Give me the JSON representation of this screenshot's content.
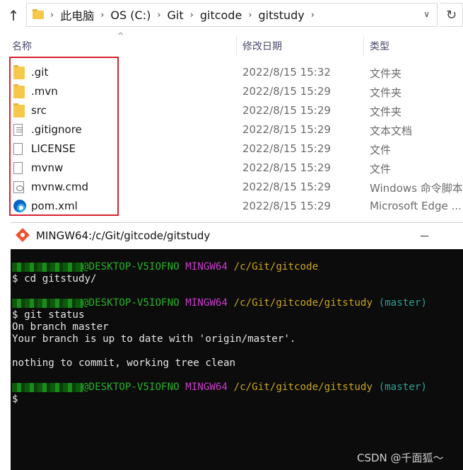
{
  "explorer": {
    "breadcrumb": [
      "此电脑",
      "OS (C:)",
      "Git",
      "gitcode",
      "gitstudy"
    ],
    "columns": {
      "name": "名称",
      "date": "修改日期",
      "type": "类型"
    },
    "files": [
      {
        "name": ".git",
        "date": "2022/8/15 15:32",
        "type": "文件夹",
        "icon": "folder-icon"
      },
      {
        "name": ".mvn",
        "date": "2022/8/15 15:29",
        "type": "文件夹",
        "icon": "folder-icon"
      },
      {
        "name": "src",
        "date": "2022/8/15 15:29",
        "type": "文件夹",
        "icon": "folder-icon"
      },
      {
        "name": ".gitignore",
        "date": "2022/8/15 15:29",
        "type": "文本文档",
        "icon": "text-file-icon"
      },
      {
        "name": "LICENSE",
        "date": "2022/8/15 15:29",
        "type": "文件",
        "icon": "file-icon"
      },
      {
        "name": "mvnw",
        "date": "2022/8/15 15:29",
        "type": "文件",
        "icon": "file-icon"
      },
      {
        "name": "mvnw.cmd",
        "date": "2022/8/15 15:29",
        "type": "Windows 命令脚本",
        "icon": "cmd-file-icon"
      },
      {
        "name": "pom.xml",
        "date": "2022/8/15 15:29",
        "type": "Microsoft Edge ...",
        "icon": "edge-icon"
      }
    ],
    "highlight_color": "#d9202f"
  },
  "terminal": {
    "title": "MINGW64:/c/Git/gitcode/gitstudy",
    "host": "@DESKTOP-V5IOFNO",
    "shell": "MINGW64",
    "path1": "/c/Git/gitcode",
    "path2": "/c/Git/gitcode/gitstudy",
    "branch": "(master)",
    "cmd1": "$ cd gitstudy/",
    "cmd2": "$ git status",
    "out1": "On branch master",
    "out2": "Your branch is up to date with 'origin/master'.",
    "out3": "nothing to commit, working tree clean",
    "prompt": "$"
  },
  "watermark": "CSDN @千面狐～"
}
